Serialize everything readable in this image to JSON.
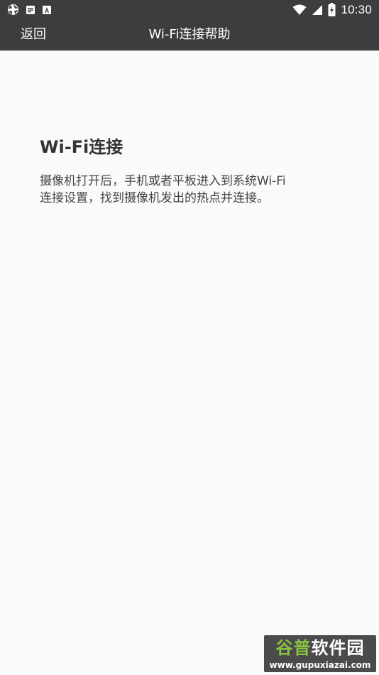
{
  "status_bar": {
    "time": "10:30",
    "left_icons": [
      "aperture-icon",
      "mail-icon",
      "font-icon"
    ],
    "right_icons": [
      "wifi-icon",
      "signal-icon",
      "battery-icon"
    ]
  },
  "toolbar": {
    "back_label": "返回",
    "title": "Wi-Fi连接帮助"
  },
  "content": {
    "heading": "Wi-Fi连接",
    "line1": "摄像机打开后，手机或者平板进入到系统Wi-Fi",
    "line2": "连接设置，找到摄像机发出的热点并连接。"
  },
  "watermark": {
    "part1": "谷普",
    "part2": "软件园",
    "url": "www.gupuxiazai.com"
  },
  "colors": {
    "toolbar_bg": "#3d3d3f",
    "page_bg": "#fafafa",
    "watermark_accent": "#8bc43f"
  }
}
